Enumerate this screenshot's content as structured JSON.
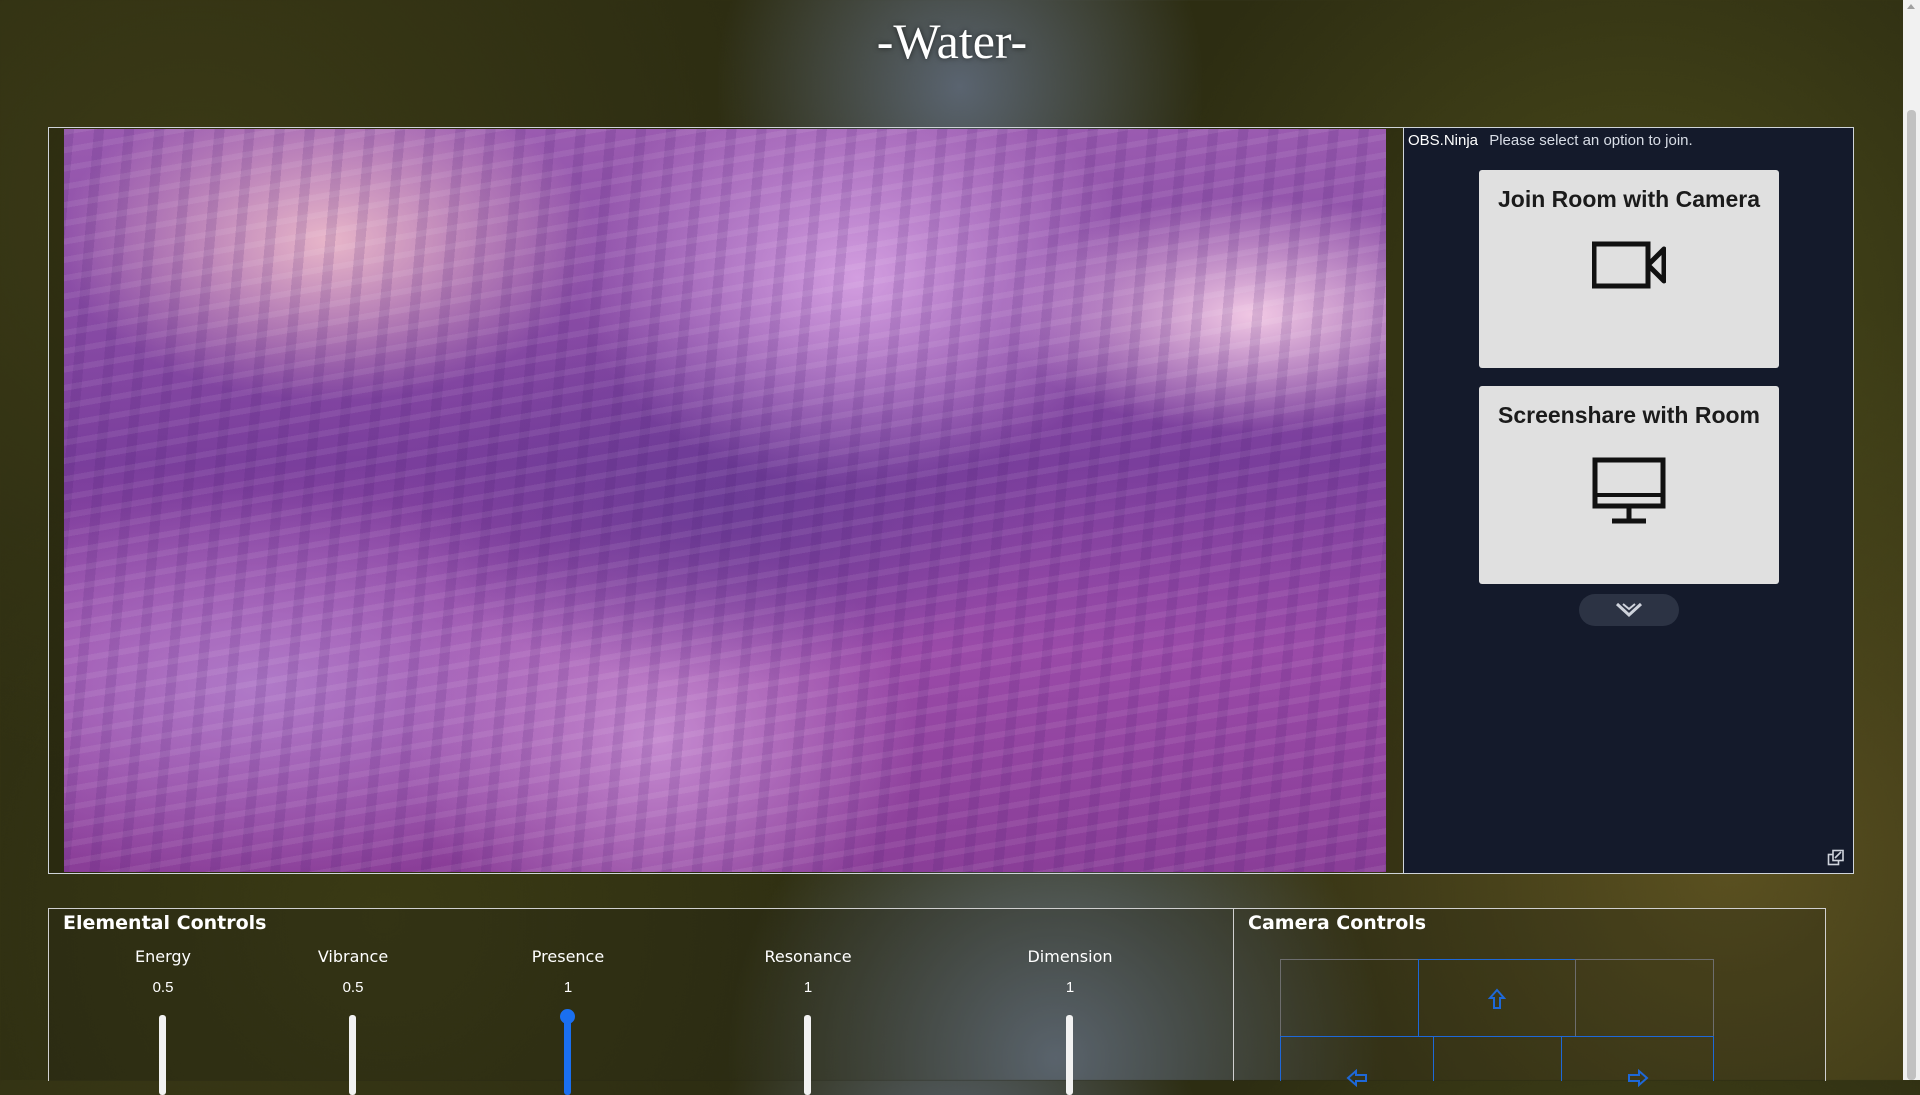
{
  "page": {
    "title": "-Water-"
  },
  "obs": {
    "brand": "OBS.Ninja",
    "message": "Please select an option to join.",
    "options": [
      {
        "label": "Join Room with Camera",
        "icon": "video-camera-icon"
      },
      {
        "label": "Screenshare with Room",
        "icon": "monitor-icon"
      }
    ],
    "more_icon": "chevron-down-icon",
    "popout_icon": "popout-icon"
  },
  "elemental": {
    "heading": "Elemental Controls",
    "sliders": [
      {
        "name": "Energy",
        "value": "0.5",
        "level": 0.5
      },
      {
        "name": "Vibrance",
        "value": "0.5",
        "level": 0.5
      },
      {
        "name": "Presence",
        "value": "1",
        "level": 1
      },
      {
        "name": "Resonance",
        "value": "1",
        "level": 1
      },
      {
        "name": "Dimension",
        "value": "1",
        "level": 1
      }
    ]
  },
  "camera": {
    "heading": "Camera Controls",
    "buttons": [
      "up-arrow-icon",
      "left-arrow-icon",
      "right-arrow-icon"
    ]
  },
  "colors": {
    "accent": "#1a6ff0",
    "panel_bg": "#141a2b",
    "card_bg": "#e0e0e0"
  }
}
